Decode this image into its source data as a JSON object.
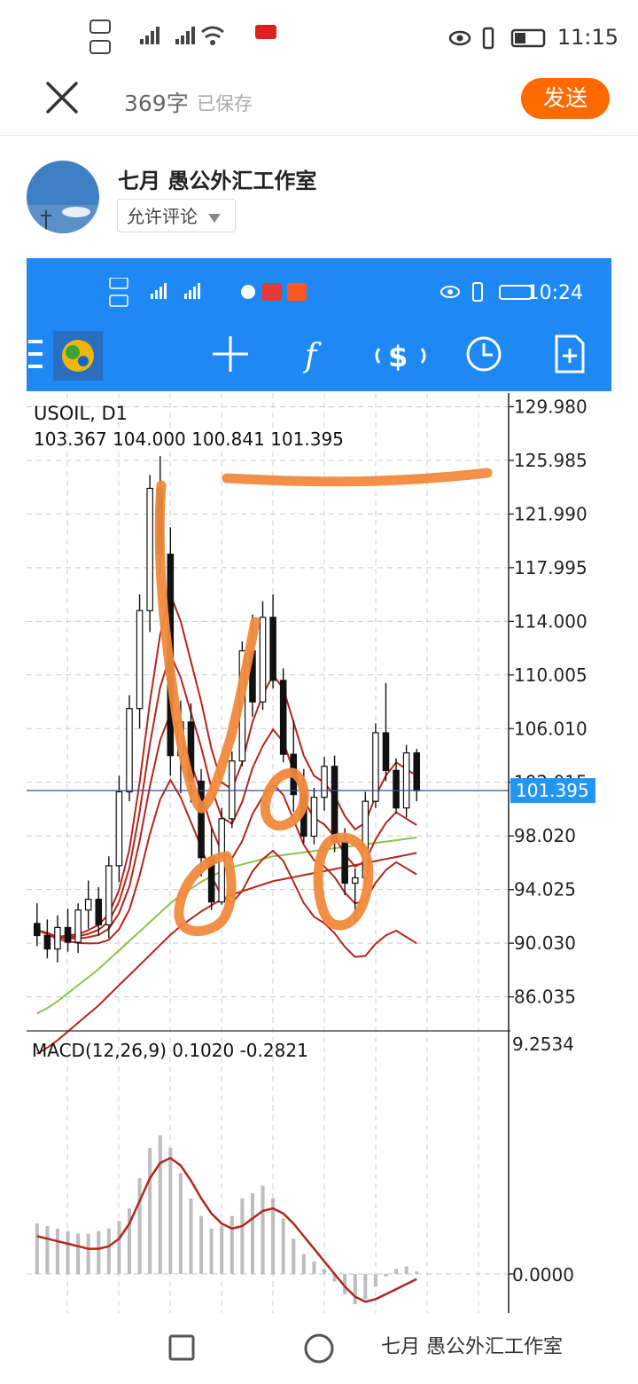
{
  "status_bar": {
    "time": "11:15"
  },
  "editor": {
    "word_count": "369字",
    "save_status": "已保存",
    "send_label": "发送",
    "author_name": "七月 愚公外汇工作室",
    "comment_setting": "允许评论"
  },
  "screenshot": {
    "status_time": "10:24",
    "chart_header": {
      "symbol": "USOIL, D1",
      "ohlc": "103.367 104.000 100.841 101.395"
    },
    "current_price": "101.395",
    "macd_header": "MACD(12,26,9) 0.1020 -0.2821",
    "macd_top": "9.2534",
    "macd_zero": "0.0000"
  },
  "chart_data": {
    "type": "line",
    "title": "USOIL, D1",
    "ylabel": "",
    "y_ticks": [
      "129.980",
      "125.985",
      "121.990",
      "117.995",
      "114.000",
      "110.005",
      "106.010",
      "102.015",
      "98.020",
      "94.025",
      "90.030",
      "86.035"
    ],
    "ylim": [
      83.5,
      131.0
    ],
    "current_price": 101.395,
    "candles": [
      [
        91.5,
        93.0,
        89.8,
        90.6
      ],
      [
        90.6,
        91.8,
        88.9,
        89.6
      ],
      [
        89.6,
        92.1,
        88.6,
        91.2
      ],
      [
        91.2,
        92.6,
        89.4,
        90.1
      ],
      [
        90.1,
        93.0,
        89.3,
        92.5
      ],
      [
        92.5,
        94.7,
        91.1,
        93.3
      ],
      [
        93.3,
        94.2,
        90.6,
        91.4
      ],
      [
        91.4,
        96.5,
        90.4,
        95.8
      ],
      [
        95.8,
        102.5,
        94.6,
        101.3
      ],
      [
        101.3,
        108.5,
        100.6,
        107.5
      ],
      [
        107.5,
        116.0,
        106.0,
        114.8
      ],
      [
        114.8,
        124.9,
        113.2,
        123.9
      ],
      [
        123.9,
        126.3,
        117.5,
        119.0
      ],
      [
        119.0,
        121.0,
        102.5,
        104.0
      ],
      [
        104.0,
        108.1,
        101.2,
        106.5
      ],
      [
        106.5,
        107.9,
        100.5,
        102.1
      ],
      [
        102.1,
        103.0,
        95.0,
        96.4
      ],
      [
        96.4,
        98.6,
        92.5,
        93.1
      ],
      [
        93.1,
        100.1,
        92.9,
        99.3
      ],
      [
        99.3,
        104.3,
        98.6,
        103.6
      ],
      [
        103.6,
        112.5,
        103.2,
        111.8
      ],
      [
        111.8,
        114.5,
        106.9,
        108.0
      ],
      [
        108.0,
        115.5,
        107.4,
        114.3
      ],
      [
        114.3,
        116.0,
        109.0,
        109.6
      ],
      [
        109.6,
        110.5,
        103.5,
        104.1
      ],
      [
        104.1,
        106.6,
        99.8,
        101.1
      ],
      [
        101.1,
        103.0,
        97.5,
        98.0
      ],
      [
        98.0,
        101.6,
        97.4,
        100.9
      ],
      [
        100.9,
        103.9,
        99.9,
        103.2
      ],
      [
        103.2,
        104.0,
        96.8,
        97.6
      ],
      [
        97.6,
        98.6,
        93.6,
        94.5
      ],
      [
        94.5,
        95.6,
        91.6,
        94.9
      ],
      [
        94.9,
        101.3,
        94.4,
        100.6
      ],
      [
        100.6,
        106.4,
        100.1,
        105.7
      ],
      [
        105.7,
        109.4,
        102.1,
        102.9
      ],
      [
        102.9,
        103.8,
        99.7,
        100.1
      ],
      [
        100.1,
        104.8,
        99.4,
        104.2
      ],
      [
        104.2,
        104.5,
        100.6,
        101.4
      ]
    ],
    "ma_red": [
      91.0,
      90.8,
      90.5,
      90.6,
      90.7,
      91.0,
      91.4,
      92.2,
      94.0,
      97.0,
      102.0,
      108.0,
      113.0,
      116.0,
      114.0,
      111.0,
      108.0,
      104.5,
      102.0,
      101.5,
      103.5,
      106.5,
      108.5,
      110.0,
      109.0,
      106.5,
      104.0,
      102.5,
      102.0,
      101.0,
      99.5,
      98.5,
      99.0,
      101.0,
      102.5,
      103.5,
      103.0,
      102.5
    ],
    "ma_sma200": [
      87.8,
      88.2,
      88.7,
      89.3,
      89.9,
      90.5,
      91.1,
      91.8,
      92.5,
      93.2,
      93.9,
      94.6,
      95.3,
      96.0,
      96.6,
      97.1,
      97.6,
      98.0,
      98.4,
      98.7,
      98.9,
      99.1,
      99.3,
      99.5,
      99.6,
      99.7,
      99.8,
      99.9,
      100.0,
      100.1,
      100.2,
      100.3,
      100.4,
      100.5,
      100.6,
      100.7,
      100.8,
      100.9
    ],
    "macd_hist": [
      2.0,
      1.9,
      1.8,
      1.7,
      1.6,
      1.6,
      1.7,
      1.8,
      2.1,
      2.6,
      3.8,
      5.0,
      5.5,
      5.0,
      4.0,
      3.0,
      2.3,
      1.8,
      1.9,
      2.3,
      3.0,
      3.2,
      3.5,
      3.0,
      2.2,
      1.4,
      0.8,
      0.5,
      0.2,
      -0.3,
      -0.8,
      -1.2,
      -1.0,
      -0.5,
      -0.1,
      0.2,
      0.3,
      0.1
    ]
  }
}
